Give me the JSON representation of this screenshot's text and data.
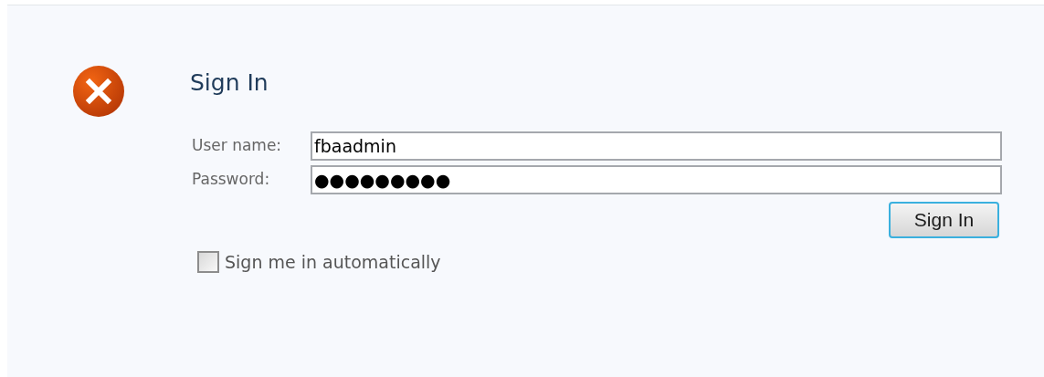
{
  "title": "Sign In",
  "fields": [
    {
      "label": "User name:",
      "value": "fbaadmin"
    },
    {
      "label": "Password:",
      "value": "●●●●●●●●●"
    }
  ],
  "button": "Sign In",
  "checkbox": {
    "label": "Sign me in automatically",
    "checked": false
  }
}
